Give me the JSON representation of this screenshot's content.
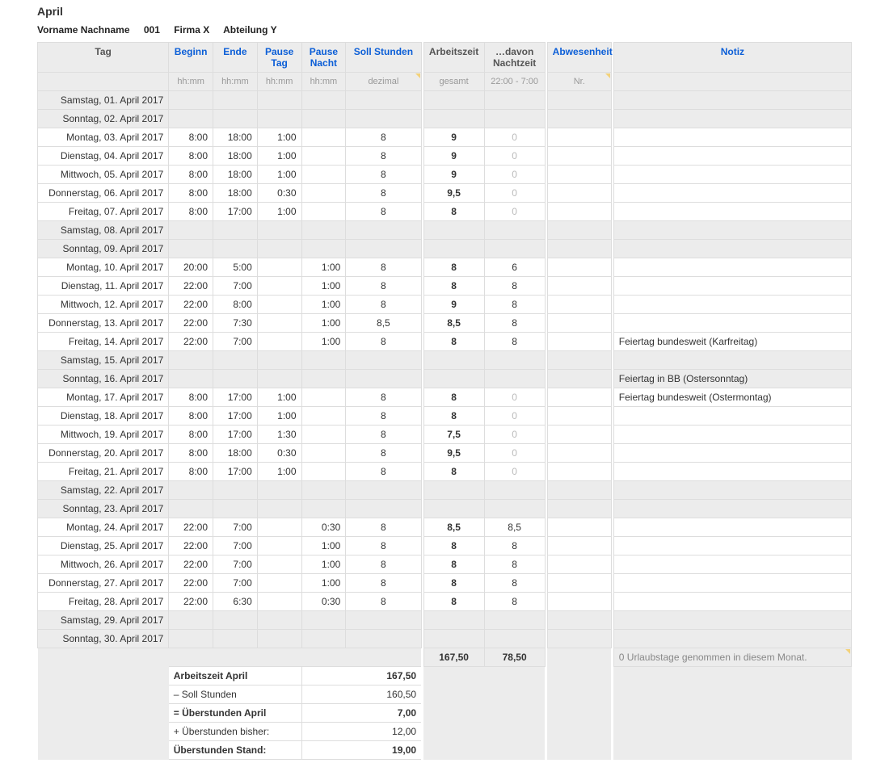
{
  "title": "April",
  "employee": {
    "name": "Vorname Nachname",
    "id": "001",
    "company": "Firma X",
    "department": "Abteilung Y"
  },
  "headers": {
    "tag": "Tag",
    "beginn": "Beginn",
    "ende": "Ende",
    "pause_tag": "Pause Tag",
    "pause_nacht": "Pause Nacht",
    "soll": "Soll Stunden",
    "arbeitszeit": "Arbeitszeit",
    "nachtzeit": "…davon Nachtzeit",
    "abwesenheit": "Abwesenheit",
    "notiz": "Notiz",
    "sub": {
      "hhmm": "hh:mm",
      "dezimal": "dezimal",
      "gesamt": "gesamt",
      "nacht_span": "22:00 - 7:00",
      "nr": "Nr."
    }
  },
  "rows": [
    {
      "tag": "Samstag, 01. April 2017",
      "weekend": true
    },
    {
      "tag": "Sonntag, 02. April 2017",
      "weekend": true
    },
    {
      "tag": "Montag, 03. April 2017",
      "beginn": "8:00",
      "ende": "18:00",
      "ptag": "1:00",
      "pnacht": "",
      "soll": "8",
      "arb": "9",
      "nacht": "0"
    },
    {
      "tag": "Dienstag, 04. April 2017",
      "beginn": "8:00",
      "ende": "18:00",
      "ptag": "1:00",
      "pnacht": "",
      "soll": "8",
      "arb": "9",
      "nacht": "0"
    },
    {
      "tag": "Mittwoch, 05. April 2017",
      "beginn": "8:00",
      "ende": "18:00",
      "ptag": "1:00",
      "pnacht": "",
      "soll": "8",
      "arb": "9",
      "nacht": "0"
    },
    {
      "tag": "Donnerstag, 06. April 2017",
      "beginn": "8:00",
      "ende": "18:00",
      "ptag": "0:30",
      "pnacht": "",
      "soll": "8",
      "arb": "9,5",
      "nacht": "0"
    },
    {
      "tag": "Freitag, 07. April 2017",
      "beginn": "8:00",
      "ende": "17:00",
      "ptag": "1:00",
      "pnacht": "",
      "soll": "8",
      "arb": "8",
      "nacht": "0"
    },
    {
      "tag": "Samstag, 08. April 2017",
      "weekend": true
    },
    {
      "tag": "Sonntag, 09. April 2017",
      "weekend": true
    },
    {
      "tag": "Montag, 10. April 2017",
      "beginn": "20:00",
      "ende": "5:00",
      "ptag": "",
      "pnacht": "1:00",
      "soll": "8",
      "arb": "8",
      "nacht": "6"
    },
    {
      "tag": "Dienstag, 11. April 2017",
      "beginn": "22:00",
      "ende": "7:00",
      "ptag": "",
      "pnacht": "1:00",
      "soll": "8",
      "arb": "8",
      "nacht": "8"
    },
    {
      "tag": "Mittwoch, 12. April 2017",
      "beginn": "22:00",
      "ende": "8:00",
      "ptag": "",
      "pnacht": "1:00",
      "soll": "8",
      "arb": "9",
      "nacht": "8"
    },
    {
      "tag": "Donnerstag, 13. April 2017",
      "beginn": "22:00",
      "ende": "7:30",
      "ptag": "",
      "pnacht": "1:00",
      "soll": "8,5",
      "arb": "8,5",
      "nacht": "8"
    },
    {
      "tag": "Freitag, 14. April 2017",
      "beginn": "22:00",
      "ende": "7:00",
      "ptag": "",
      "pnacht": "1:00",
      "soll": "8",
      "arb": "8",
      "nacht": "8",
      "notiz": "Feiertag bundesweit (Karfreitag)"
    },
    {
      "tag": "Samstag, 15. April 2017",
      "weekend": true
    },
    {
      "tag": "Sonntag, 16. April 2017",
      "weekend": true,
      "notiz": "Feiertag in BB (Ostersonntag)"
    },
    {
      "tag": "Montag, 17. April 2017",
      "beginn": "8:00",
      "ende": "17:00",
      "ptag": "1:00",
      "pnacht": "",
      "soll": "8",
      "arb": "8",
      "nacht": "0",
      "notiz": "Feiertag bundesweit (Ostermontag)"
    },
    {
      "tag": "Dienstag, 18. April 2017",
      "beginn": "8:00",
      "ende": "17:00",
      "ptag": "1:00",
      "pnacht": "",
      "soll": "8",
      "arb": "8",
      "nacht": "0"
    },
    {
      "tag": "Mittwoch, 19. April 2017",
      "beginn": "8:00",
      "ende": "17:00",
      "ptag": "1:30",
      "pnacht": "",
      "soll": "8",
      "arb": "7,5",
      "nacht": "0"
    },
    {
      "tag": "Donnerstag, 20. April 2017",
      "beginn": "8:00",
      "ende": "18:00",
      "ptag": "0:30",
      "pnacht": "",
      "soll": "8",
      "arb": "9,5",
      "nacht": "0"
    },
    {
      "tag": "Freitag, 21. April 2017",
      "beginn": "8:00",
      "ende": "17:00",
      "ptag": "1:00",
      "pnacht": "",
      "soll": "8",
      "arb": "8",
      "nacht": "0"
    },
    {
      "tag": "Samstag, 22. April 2017",
      "weekend": true
    },
    {
      "tag": "Sonntag, 23. April 2017",
      "weekend": true
    },
    {
      "tag": "Montag, 24. April 2017",
      "beginn": "22:00",
      "ende": "7:00",
      "ptag": "",
      "pnacht": "0:30",
      "soll": "8",
      "arb": "8,5",
      "nacht": "8,5"
    },
    {
      "tag": "Dienstag, 25. April 2017",
      "beginn": "22:00",
      "ende": "7:00",
      "ptag": "",
      "pnacht": "1:00",
      "soll": "8",
      "arb": "8",
      "nacht": "8"
    },
    {
      "tag": "Mittwoch, 26. April 2017",
      "beginn": "22:00",
      "ende": "7:00",
      "ptag": "",
      "pnacht": "1:00",
      "soll": "8",
      "arb": "8",
      "nacht": "8"
    },
    {
      "tag": "Donnerstag, 27. April 2017",
      "beginn": "22:00",
      "ende": "7:00",
      "ptag": "",
      "pnacht": "1:00",
      "soll": "8",
      "arb": "8",
      "nacht": "8"
    },
    {
      "tag": "Freitag, 28. April 2017",
      "beginn": "22:00",
      "ende": "6:30",
      "ptag": "",
      "pnacht": "0:30",
      "soll": "8",
      "arb": "8",
      "nacht": "8"
    },
    {
      "tag": "Samstag, 29. April 2017",
      "weekend": true
    },
    {
      "tag": "Sonntag, 30. April 2017",
      "weekend": true
    }
  ],
  "totals": {
    "arb": "167,50",
    "nacht": "78,50",
    "note": "0 Urlaubstage genommen in diesem Monat."
  },
  "summary": {
    "arbeitszeit_label": "Arbeitszeit April",
    "arbeitszeit_val": "167,50",
    "soll_label": "– Soll Stunden",
    "soll_val": "160,50",
    "ueberst_label": "= Überstunden April",
    "ueberst_val": "7,00",
    "bisher_label": "+ Überstunden bisher:",
    "bisher_val": "12,00",
    "stand_label": "Überstunden Stand:",
    "stand_val": "19,00"
  }
}
